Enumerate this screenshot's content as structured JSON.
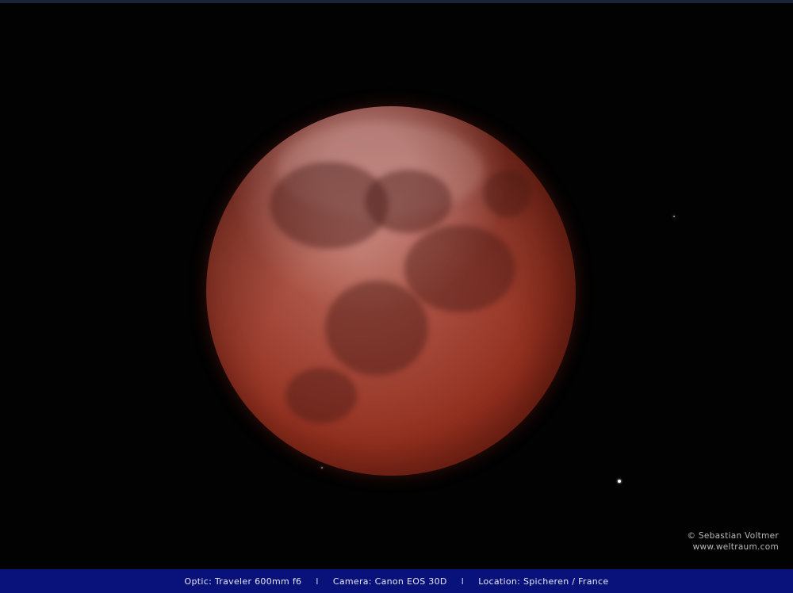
{
  "photo": {
    "subject": "total lunar eclipse (red moon)",
    "colors": {
      "sky": "#020202",
      "moon_core": "#a4483a",
      "moon_rim": "#5a1a10",
      "infobar": "#08127a"
    }
  },
  "credit": {
    "author": "© Sebastian Voltmer",
    "website": "www.weltraum.com"
  },
  "infobar": {
    "optic": "Optic: Traveler 600mm f6",
    "separator": "I",
    "camera": "Camera: Canon EOS 30D",
    "location": "Location: Spicheren / France"
  }
}
